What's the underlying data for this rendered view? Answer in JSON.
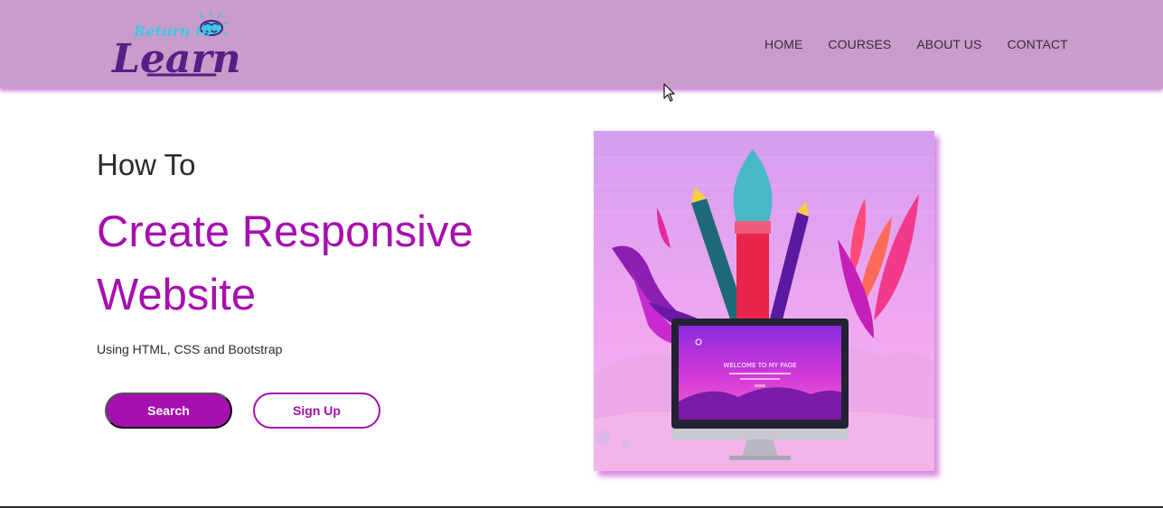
{
  "brand": {
    "logo_small": "Return to",
    "logo_large": "Learn"
  },
  "nav": {
    "items": [
      {
        "label": "HOME"
      },
      {
        "label": "COURSES"
      },
      {
        "label": "ABOUT US"
      },
      {
        "label": "CONTACT"
      }
    ]
  },
  "hero": {
    "pretitle": "How To",
    "title": "Create Responsive Website",
    "subtitle": "Using HTML, CSS and Bootstrap",
    "primary_button": "Search",
    "secondary_button": "Sign Up",
    "image_screen_text": "WELCOME TO MY PAGE"
  },
  "colors": {
    "navbar_bg": "#c99ccb",
    "accent": "#a60fb0",
    "text_dark": "#2e2a2e",
    "background": "#ffffff"
  },
  "icons": {
    "logo": "brain-icon",
    "cursor": "mouse-pointer-icon"
  }
}
